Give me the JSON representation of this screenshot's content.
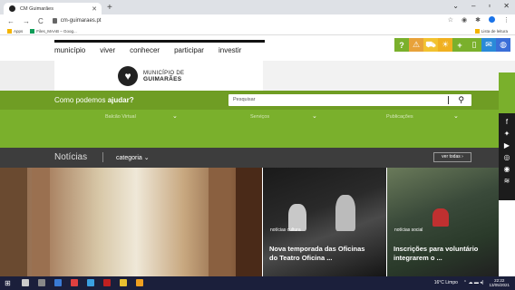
{
  "browser": {
    "tab_title": "CM Guimarães",
    "url": "cm-guimaraes.pt",
    "bookmarks": [
      {
        "label": "Apps"
      },
      {
        "label": "Files_MAAB – Goog..."
      }
    ],
    "reading_list": "Lista de leitura"
  },
  "site": {
    "menu": [
      "município",
      "viver",
      "conhecer",
      "participar",
      "investir"
    ],
    "logo": {
      "line1": "MUNICÍPIO DE",
      "line2": "GUIMARÃES"
    },
    "help_prefix": "Como podemos ",
    "help_bold": "ajudar?",
    "search_placeholder": "Pesquisar",
    "quick_links": [
      "Balcão Virtual",
      "Serviços",
      "Publicações"
    ],
    "news_heading": "Notícias",
    "news_category": "categoria",
    "news_all": "ver todas",
    "cards": [
      {
        "tag": "notícias cultura",
        "title_line1": "Nova temporada das Oficinas",
        "title_line2": "do Teatro Oficina ..."
      },
      {
        "tag": "notícias social",
        "title_line1": "Inscrições para voluntário",
        "title_line2": "integrarem o ..."
      }
    ]
  },
  "taskbar": {
    "weather": "16°C  Limpo",
    "time": "22:22",
    "date": "13/05/2021"
  },
  "colors": {
    "green_dark": "#6f9d24",
    "green": "#7ab02c",
    "news_bar": "#3d3d3d",
    "taskbar": "#1b1f3b"
  }
}
